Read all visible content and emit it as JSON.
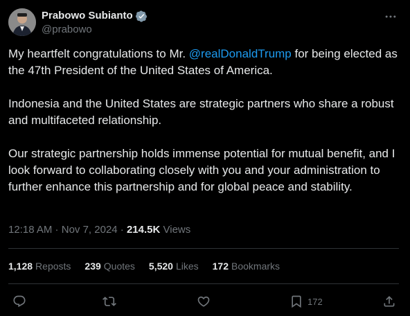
{
  "author": {
    "display_name": "Prabowo Subianto",
    "handle": "@prabowo",
    "verified": true,
    "avatar_icon": "profile-photo"
  },
  "post": {
    "paragraphs": [
      {
        "before": "My heartfelt congratulations to Mr. ",
        "mention": "@realDonaldTrump",
        "after": " for being elected as the 47th President of the United States of America."
      },
      {
        "text": "Indonesia and the United States are strategic partners who share a robust and multifaceted relationship."
      },
      {
        "text": "Our strategic partnership holds immense potential for mutual benefit, and I look forward to collaborating closely with you and your administration to further enhance this partnership and for global peace and stability."
      }
    ]
  },
  "meta": {
    "time": "12:18 AM",
    "separator": " · ",
    "date": "Nov 7, 2024",
    "separator2": " · ",
    "views_count": "214.5K",
    "views_label": " Views"
  },
  "stats": {
    "reposts": {
      "num": "1,128",
      "label": "Reposts"
    },
    "quotes": {
      "num": "239",
      "label": "Quotes"
    },
    "likes": {
      "num": "5,520",
      "label": "Likes"
    },
    "bookmarks": {
      "num": "172",
      "label": "Bookmarks"
    }
  },
  "actions": {
    "bookmark_count": "172"
  },
  "colors": {
    "background": "#000000",
    "text": "#e7e9ea",
    "secondary": "#71767b",
    "accent": "#1d9bf0",
    "divider": "#2f3336"
  }
}
